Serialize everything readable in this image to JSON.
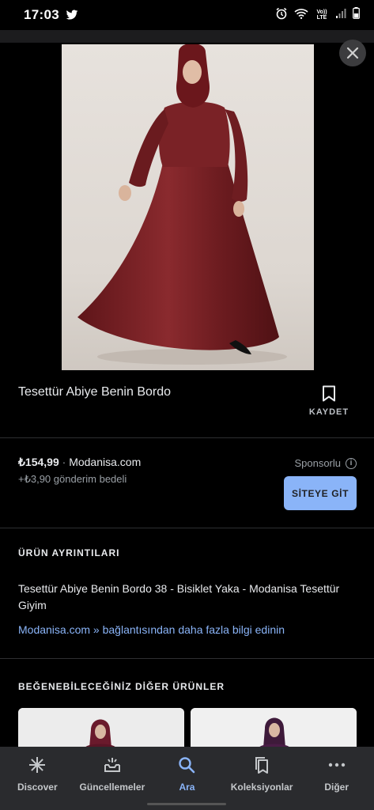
{
  "status_bar": {
    "time": "17:03",
    "network_label": "Vo)) LTE"
  },
  "product": {
    "title": "Tesettür Abiye Benin Bordo",
    "save_label": "KAYDET",
    "price": "₺154,99",
    "separator": " · ",
    "merchant": "Modanisa.com",
    "shipping": "+₺3,90 gönderim bedeli",
    "sponsored_label": "Sponsorlu",
    "visit_button": "SİTEYE GİT"
  },
  "details": {
    "heading": "ÜRÜN AYRINTILARI",
    "description": "Tesettür Abiye Benin Bordo 38 - Bisiklet Yaka - Modanisa Tesettür Giyim",
    "more_link": "Modanisa.com » bağlantısından daha fazla bilgi edinin"
  },
  "related": {
    "heading": "BEĞENEBİLECEĞİNİZ DİĞER ÜRÜNLER"
  },
  "bottom_nav": {
    "items": [
      {
        "label": "Discover",
        "icon": "asterisk-icon",
        "active": false
      },
      {
        "label": "Güncellemeler",
        "icon": "updates-icon",
        "active": false
      },
      {
        "label": "Ara",
        "icon": "search-icon",
        "active": true
      },
      {
        "label": "Koleksiyonlar",
        "icon": "collections-icon",
        "active": false
      },
      {
        "label": "Diğer",
        "icon": "more-icon",
        "active": false
      }
    ]
  },
  "colors": {
    "background": "#000000",
    "accent": "#8ab4f8",
    "dress": "#7a1f24"
  }
}
